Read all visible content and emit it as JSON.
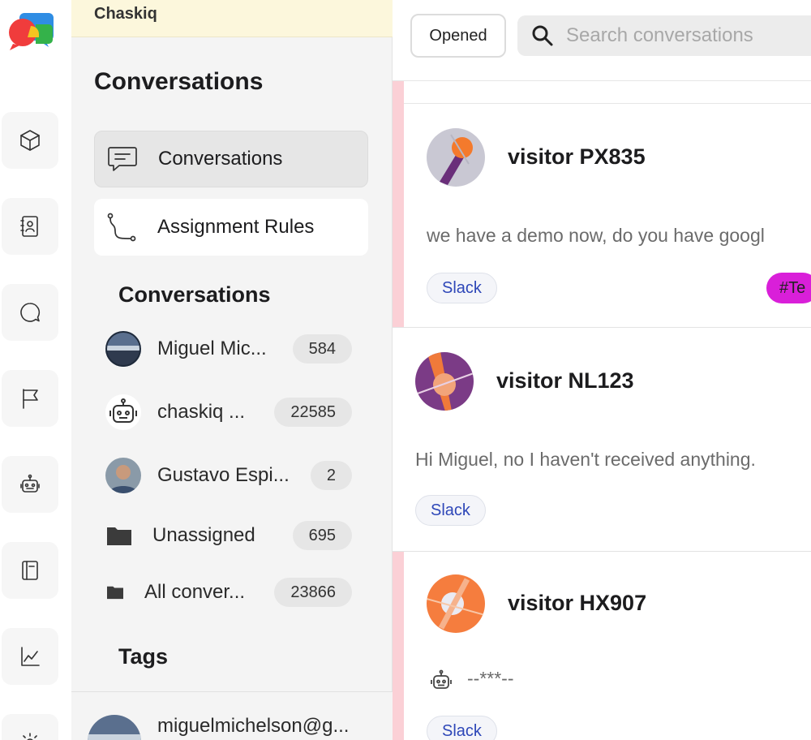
{
  "app": {
    "name": "Chaskiq"
  },
  "sidebar": {
    "title": "Conversations",
    "nav": [
      {
        "label": "Conversations",
        "icon": "chat-bubble-icon",
        "active": true
      },
      {
        "label": "Assignment Rules",
        "icon": "route-icon",
        "active": false
      }
    ],
    "section_title": "Conversations",
    "agents": [
      {
        "label": "Miguel Mic...",
        "count": "584",
        "icon": "avatar-photo"
      },
      {
        "label": "chaskiq ...",
        "count": "22585",
        "icon": "robot-icon"
      },
      {
        "label": "Gustavo Espi...",
        "count": "2",
        "icon": "avatar-photo"
      }
    ],
    "folders": [
      {
        "label": "Unassigned",
        "count": "695",
        "icon": "folder-icon"
      },
      {
        "label": "All conver...",
        "count": "23866",
        "icon": "folder-icon"
      }
    ],
    "tags_title": "Tags",
    "footer": {
      "email": "miguelmichelson@g..."
    }
  },
  "rail": {
    "icons": [
      "cube-icon",
      "contacts-icon",
      "chat-icon",
      "flag-icon",
      "robot-icon",
      "book-icon",
      "chart-icon",
      "gear-icon"
    ]
  },
  "main": {
    "filter_label": "Opened",
    "search": {
      "placeholder": "Search conversations",
      "value": ""
    },
    "conversations": [
      {
        "name": "visitor PX835",
        "message": "we have a demo now, do you have googl",
        "channel": "Slack",
        "tag": "#Te",
        "avatar_color": "#c7c7d1"
      },
      {
        "name": "visitor NL123",
        "message": "Hi Miguel, no I haven't received anything.",
        "channel": "Slack",
        "avatar_color": "#7b3b86"
      },
      {
        "name": "visitor HX907",
        "message": "--***--",
        "channel": "Slack",
        "avatar_color": "#f57d3e"
      }
    ]
  },
  "colors": {
    "stripe": "#fbd0d6",
    "channel_text": "#2e47b8",
    "tag_bg": "#d91fd9",
    "app_bar": "#fcf7dc"
  }
}
